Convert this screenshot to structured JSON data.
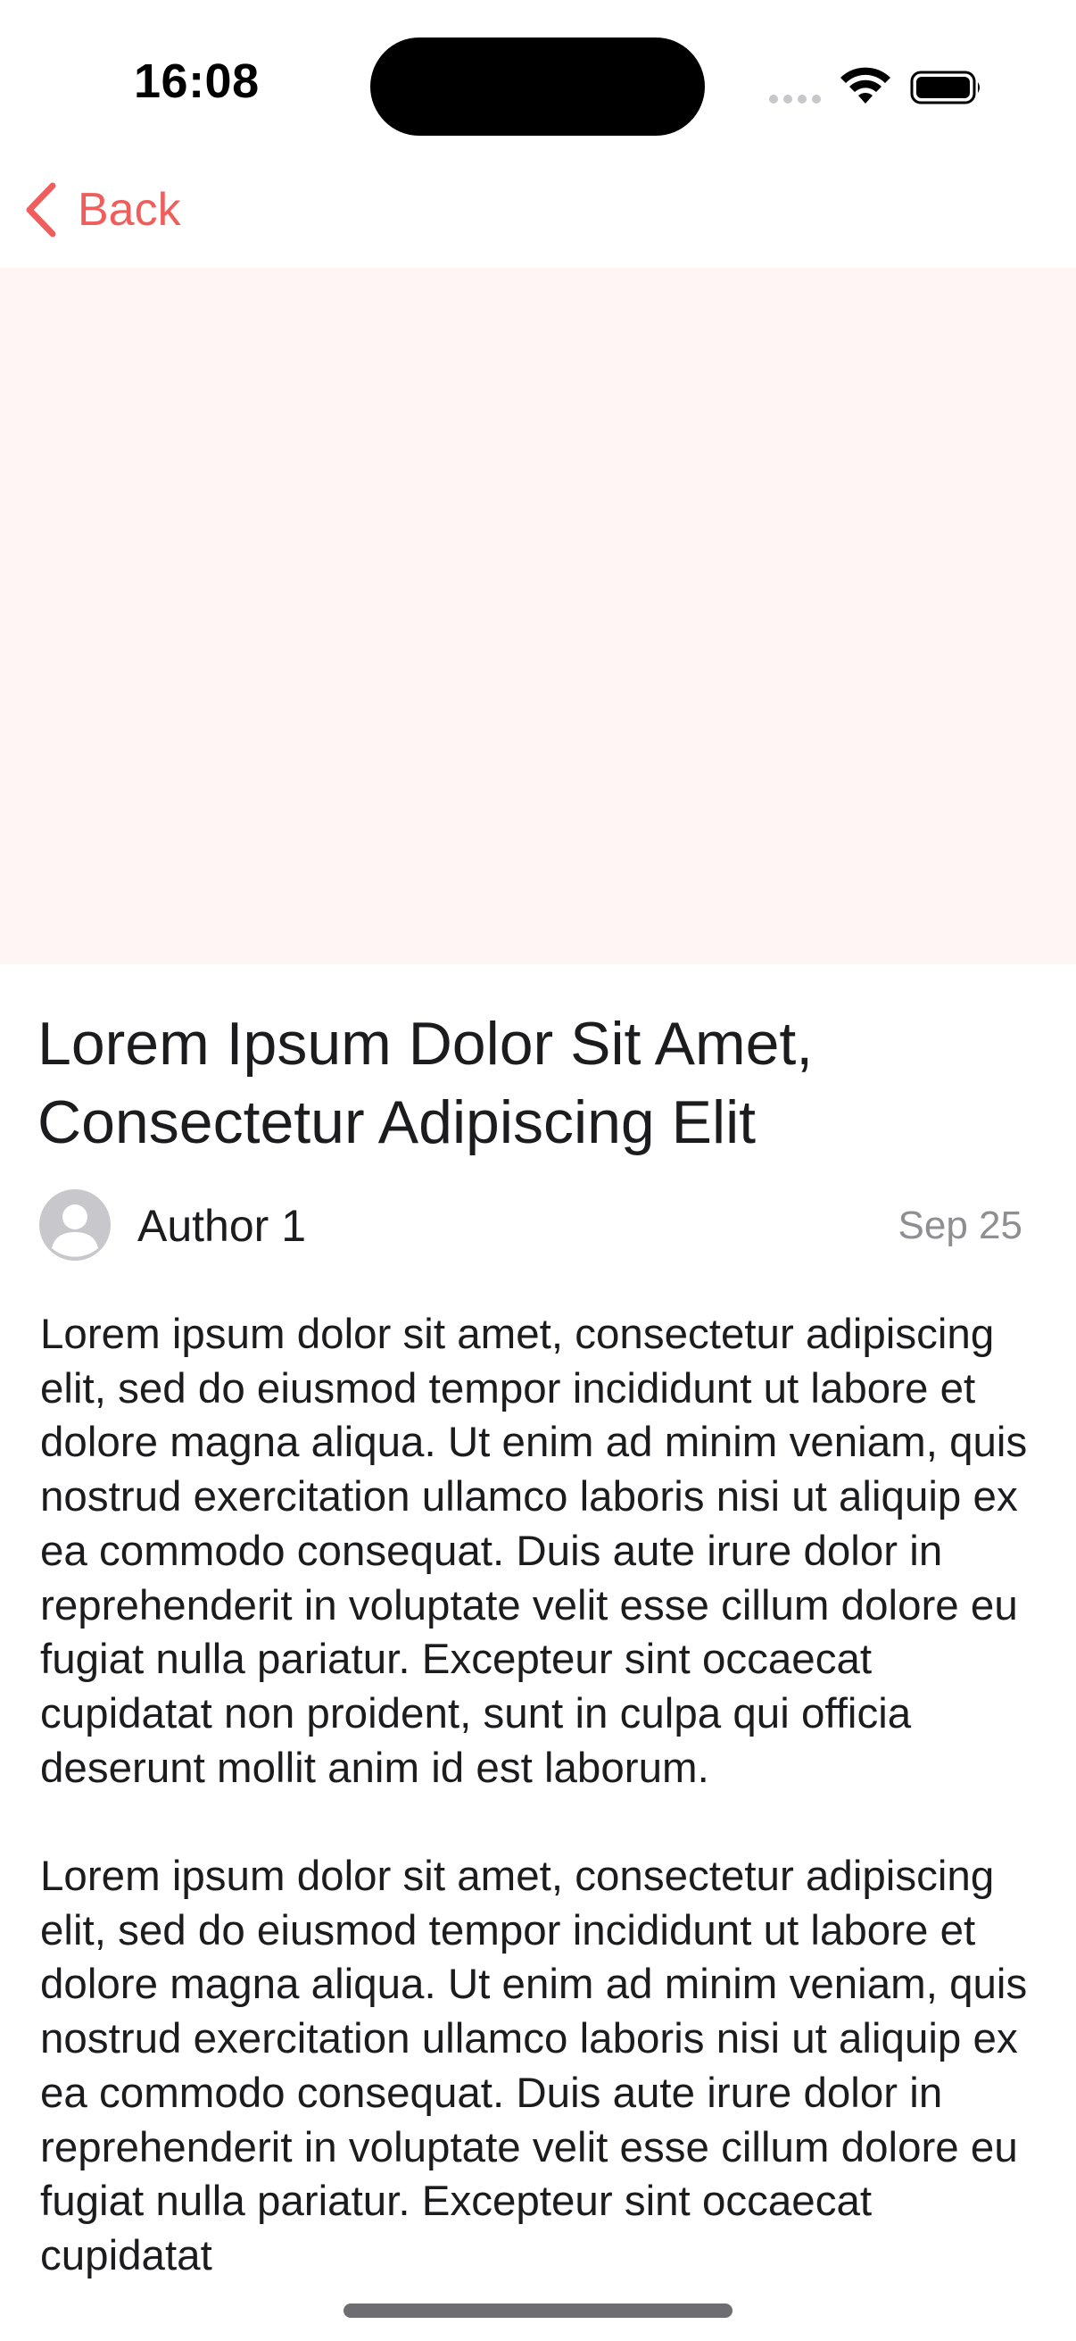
{
  "status_bar": {
    "time": "16:08"
  },
  "nav": {
    "back_label": "Back",
    "accent_color": "#f05d5d"
  },
  "hero": {
    "background_color": "#fff5f4"
  },
  "article": {
    "title": "Lorem Ipsum Dolor Sit Amet, Consectetur Adipiscing Elit",
    "author": "Author 1",
    "date": "Sep 25",
    "paragraphs": [
      "Lorem ipsum dolor sit amet, consectetur adipiscing elit, sed do eiusmod tempor incididunt ut labore et dolore magna aliqua. Ut enim ad minim veniam, quis nostrud exercitation ullamco laboris nisi ut aliquip ex ea commodo consequat. Duis aute irure dolor in reprehenderit in voluptate velit esse cillum dolore eu fugiat nulla pariatur. Excepteur sint occaecat cupidatat non proident, sunt in culpa qui officia deserunt mollit anim id est laborum.",
      "Lorem ipsum dolor sit amet, consectetur adipiscing elit, sed do eiusmod tempor incididunt ut labore et dolore magna aliqua. Ut enim ad minim veniam, quis nostrud exercitation ullamco laboris nisi ut aliquip ex ea commodo consequat. Duis aute irure dolor in reprehenderit in voluptate velit esse cillum dolore eu fugiat nulla pariatur. Excepteur sint occaecat cupidatat"
    ]
  },
  "icons": {
    "back": "chevron-left-icon",
    "avatar": "person-circle-icon",
    "wifi": "wifi-icon",
    "battery": "battery-icon",
    "signal": "signal-icon"
  }
}
